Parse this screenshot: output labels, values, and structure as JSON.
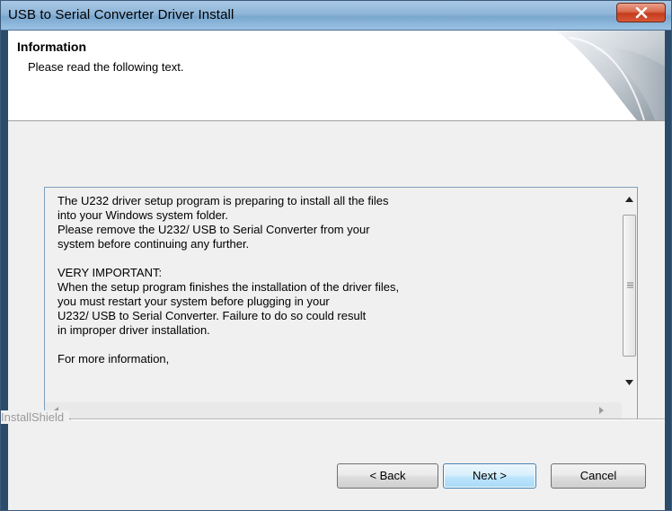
{
  "window": {
    "title": "USB to Serial Converter Driver Install"
  },
  "header": {
    "title": "Information",
    "subtitle": "Please read the following text."
  },
  "textbox": {
    "text": "The U232 driver setup program is preparing to install all the files\ninto your Windows system folder.\nPlease remove the U232/ USB to Serial Converter from your\nsystem before continuing any further.\n\nVERY IMPORTANT:\nWhen the setup program finishes the installation of the driver files,\nyou must restart your system before plugging in your\nU232/ USB to Serial Converter. Failure to do so could result\nin improper driver installation.\n\nFor more information,"
  },
  "footer": {
    "brand": "InstallShield"
  },
  "buttons": {
    "back": "< Back",
    "next": "Next >",
    "cancel": "Cancel"
  },
  "colors": {
    "titlebar": "#8fb5d8",
    "close_button": "#c43c1e",
    "dialog_bg": "#f0f0f0",
    "default_button_border": "#3c7fb1"
  },
  "icons": [
    "close-icon",
    "scroll-up-icon",
    "scroll-down-icon",
    "scroll-grip-icon",
    "scroll-left-icon",
    "scroll-right-icon",
    "header-graphic"
  ]
}
